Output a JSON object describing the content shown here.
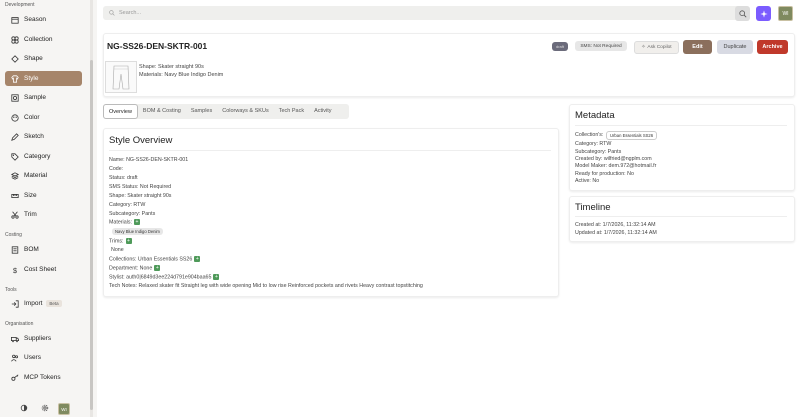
{
  "sidebar": {
    "sections": {
      "development": "Development",
      "costing": "Costing",
      "tools": "Tools",
      "organisation": "Organisation"
    },
    "items": [
      {
        "label": "Season",
        "icon": "calendar-icon"
      },
      {
        "label": "Collection",
        "icon": "collection-icon"
      },
      {
        "label": "Shape",
        "icon": "shape-icon"
      },
      {
        "label": "Style",
        "icon": "shirt-icon"
      },
      {
        "label": "Sample",
        "icon": "sample-icon"
      },
      {
        "label": "Color",
        "icon": "palette-icon"
      },
      {
        "label": "Sketch",
        "icon": "sketch-icon"
      },
      {
        "label": "Category",
        "icon": "tag-icon"
      },
      {
        "label": "Material",
        "icon": "layers-icon"
      },
      {
        "label": "Size",
        "icon": "ruler-icon"
      },
      {
        "label": "Trim",
        "icon": "scissors-icon"
      },
      {
        "label": "BOM",
        "icon": "bom-icon"
      },
      {
        "label": "Cost Sheet",
        "icon": "dollar-icon"
      },
      {
        "label": "Import",
        "icon": "import-icon",
        "badge": "Beta"
      },
      {
        "label": "Suppliers",
        "icon": "truck-icon"
      },
      {
        "label": "Users",
        "icon": "users-icon"
      },
      {
        "label": "MCP Tokens",
        "icon": "key-icon"
      }
    ],
    "avatar": "WI"
  },
  "header": {
    "search_placeholder": "Search...",
    "avatar": "WI"
  },
  "style": {
    "name": "NG-SS26-DEN-SKTR-001",
    "status_chip": "draft",
    "sms_chip": "SMS: Not Required",
    "ask_copilot": "Ask Copilot",
    "edit": "Edit",
    "duplicate": "Duplicate",
    "archive": "Archive",
    "shape_line": "Shape: Skater straight 90s",
    "materials_line": "Materials: Navy Blue Indigo Denim"
  },
  "tabs": [
    "Overview",
    "BOM & Costing",
    "Samples",
    "Colorways & SKUs",
    "Tech Pack",
    "Activity"
  ],
  "overview": {
    "title": "Style Overview",
    "fields": {
      "name": "Name: NG-SS26-DEN-SKTR-001",
      "code": "Code:",
      "status": "Status: draft",
      "sms": "SMS Status: Not Required",
      "shape": "Shape: Skater straight 90s",
      "category": "Category: RTW",
      "subcategory": "Subcategory: Pants",
      "materials": "Materials:",
      "material_tag": "Navy Blue Indigo Denim",
      "trims": "Trims:",
      "trims_value": "None",
      "collections": "Collections: Urban Essentials SS26",
      "department": "Department: None",
      "stylist": "Stylist: auth0|6849d3ee224d791e904baa65",
      "tech_notes": "Tech Notes: Relaxed skater fit Straight leg with wide opening Mid to low rise Reinforced pockets and rivets Heavy contrast topstitching"
    }
  },
  "metadata": {
    "title": "Metadata",
    "collections_label": "Collection's:",
    "collections_tag": "Urban Essentials SS26",
    "category": "Category: RTW",
    "subcategory": "Subcategory: Pants",
    "created_by": "Created by: wilfried@ngplm.com",
    "model_maker": "Model Maker: dem.972@hotmail.fr",
    "ready": "Ready for production: No",
    "active": "Active: No"
  },
  "timeline": {
    "title": "Timeline",
    "created": "Created at: 1/7/2026, 11:32:14 AM",
    "updated": "Updated at: 1/7/2026, 11:32:14 AM"
  },
  "colors": {
    "accent": "#a6856a",
    "archive": "#c0392b",
    "edit": "#8b6f5c",
    "copilot": "#7b5cff",
    "plus": "#4f9a5a"
  }
}
